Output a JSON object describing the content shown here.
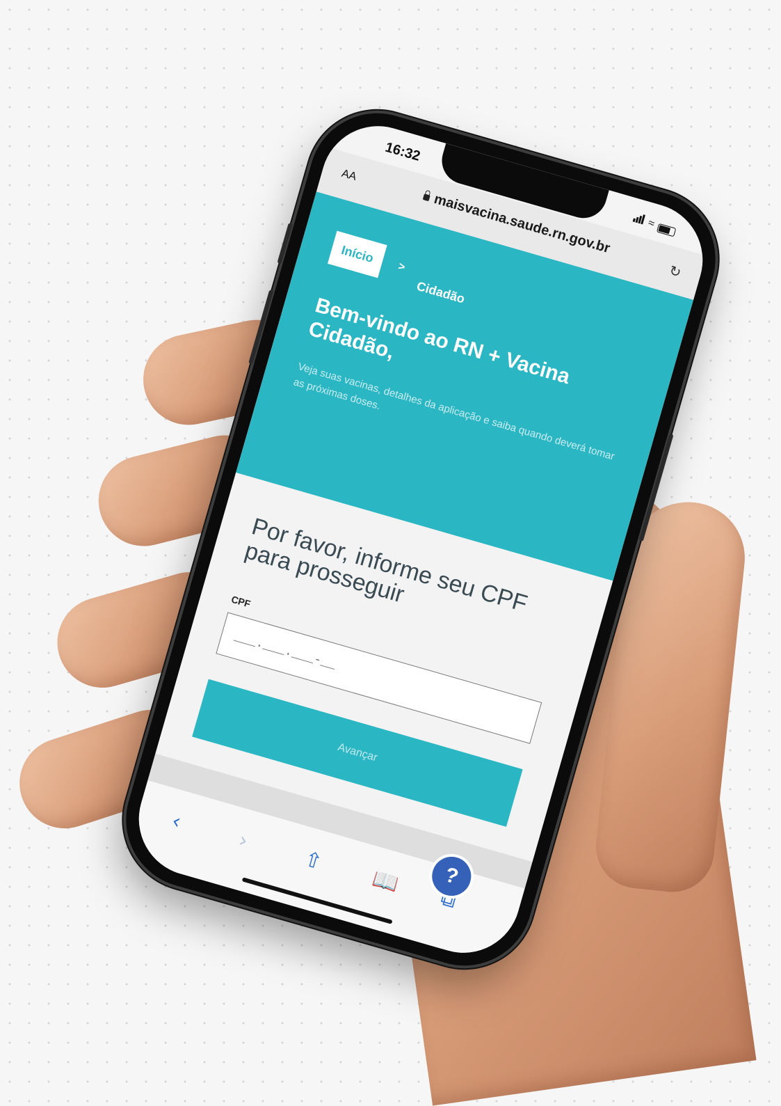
{
  "status_bar": {
    "time": "16:32"
  },
  "browser": {
    "text_size_button": "AA",
    "url": "maisvacina.saude.rn.gov.br",
    "icons": {
      "lock": "lock-icon",
      "reload": "reload-icon",
      "back": "chevron-left-icon",
      "forward": "chevron-right-icon",
      "share": "share-icon",
      "bookmarks": "book-icon",
      "tabs": "tabs-icon"
    }
  },
  "breadcrumb": {
    "home": "Início",
    "separator": ">",
    "current": "Cidadão"
  },
  "hero": {
    "title": "Bem-vindo ao RN + Vacina Cidadão,",
    "subtitle": "Veja suas vacinas, detalhes da aplicação e saiba quando deverá tomar as próximas doses."
  },
  "form": {
    "prompt": "Por favor, informe seu CPF para prosseguir",
    "cpf_label": "CPF",
    "cpf_placeholder": "___.___.___-__",
    "submit_label": "Avançar"
  },
  "help": {
    "label": "?"
  },
  "colors": {
    "primary": "#2bb6c3",
    "help_button": "#3561b8",
    "toolbar_icon": "#2f6fd1"
  }
}
